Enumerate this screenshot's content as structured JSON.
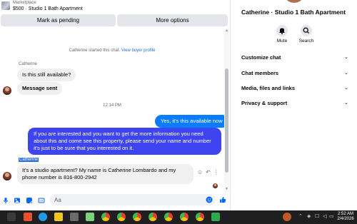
{
  "marketplace": {
    "source": "Marketplace",
    "title": "$500 · Studio 1 Bath Apartment",
    "mark_pending": "Mark as pending",
    "more_options": "More options"
  },
  "chat": {
    "started_prefix": "Catherine started this chat.",
    "view_profile": "View buyer profile",
    "sender": "Catherine",
    "messages_in_1": "Is this still available?",
    "messages_in_2": "Message sent",
    "timestamp": "12:14 PM",
    "message_out_1": "Yes, it's this available now",
    "message_out_2": "If you are interested and you want to get the more information you need about this and come see this property, please send your name and number it's just to be sure that you interested on it.",
    "sender_selected": "Catherine",
    "message_in_3": "It's a studio apartment? My name is Catherine Lombardo and my phone number is 816-800-2942",
    "composer_placeholder": "Aa"
  },
  "info": {
    "title": "Catherine · Studio 1 Bath Apartment",
    "mute_label": "Mute",
    "search_label": "Search",
    "rows": [
      "Customize chat",
      "Chat members",
      "Media, files and links",
      "Privacy & support"
    ]
  },
  "taskbar": {
    "time": "2:52 AM",
    "date": "2/4/2026"
  },
  "colors": {
    "outgoing": "#0a7cff",
    "outgoing_long": "#3d44f0",
    "incoming": "#f0f0f0",
    "accent": "#0866ff"
  }
}
